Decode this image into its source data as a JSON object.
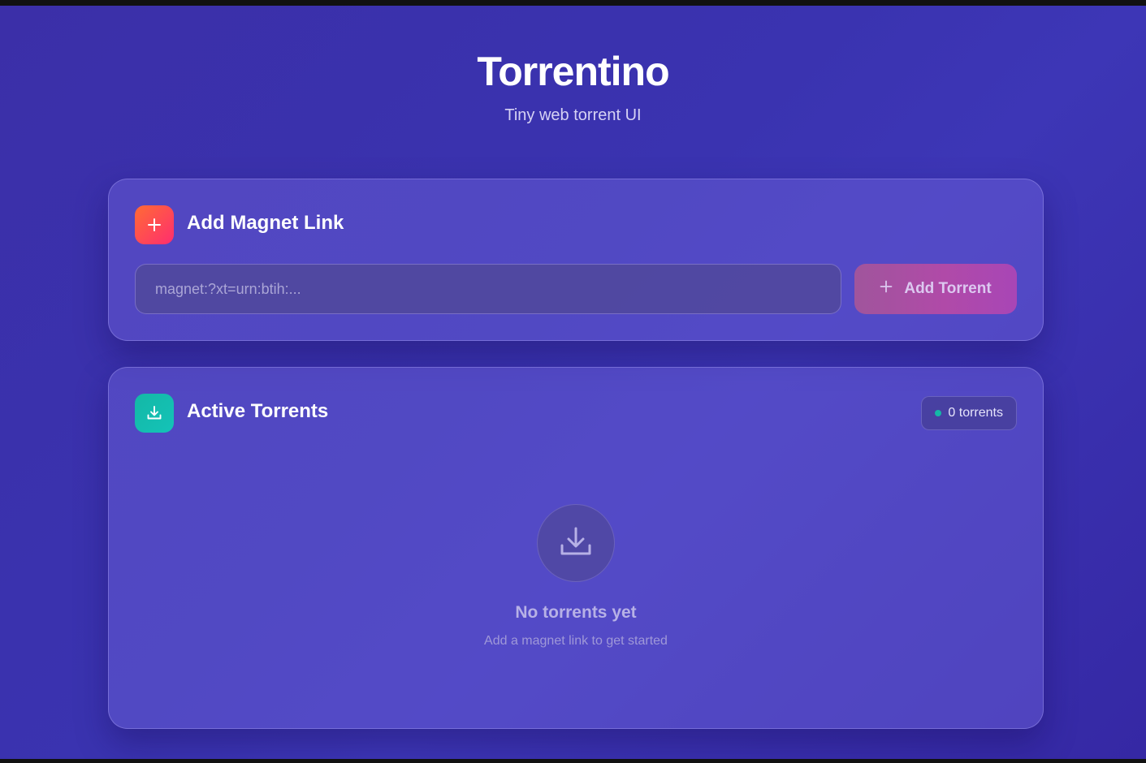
{
  "header": {
    "title": "Torrentino",
    "subtitle": "Tiny web torrent UI"
  },
  "add_card": {
    "title": "Add Magnet Link",
    "icon": "plus-icon",
    "input_placeholder": "magnet:?xt=urn:btih:...",
    "input_value": "",
    "button_label": "Add Torrent",
    "button_icon": "plus-icon"
  },
  "active_card": {
    "title": "Active Torrents",
    "icon": "download-icon",
    "badge": "0 torrents",
    "empty_icon": "download-icon",
    "empty_title": "No torrents yet",
    "empty_subtitle": "Add a magnet link to get started"
  },
  "colors": {
    "background": "#3a33b0",
    "add_icon_gradient": [
      "#ff6b35",
      "#ff2d6f"
    ],
    "download_icon_gradient": [
      "#14b8a6",
      "#14c3b8"
    ],
    "button_gradient": [
      "#a0559c",
      "#a846b6"
    ],
    "status_dot": "#14b8a6"
  }
}
